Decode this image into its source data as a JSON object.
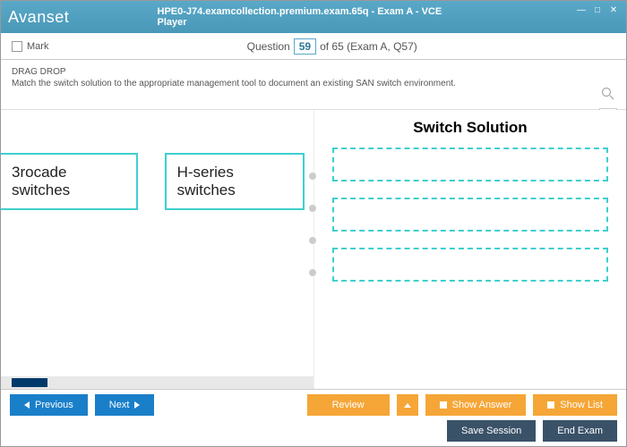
{
  "titlebar": {
    "logo": "Avanset",
    "title": "HPE0-J74.examcollection.premium.exam.65q - Exam A - VCE Player"
  },
  "toolbar": {
    "mark_label": "Mark",
    "question_label": "Question",
    "question_num": "59",
    "question_suffix": "of 65 (Exam A, Q57)"
  },
  "instruct": {
    "heading": "DRAG DROP",
    "text": "Match the switch solution to the appropriate management tool to document an existing SAN switch environment."
  },
  "content": {
    "left_items": [
      "3rocade switches",
      "H-series switches"
    ],
    "solution_title": "Switch Solution"
  },
  "footer": {
    "previous": "Previous",
    "next": "Next",
    "review": "Review",
    "show_answer": "Show Answer",
    "show_list": "Show List",
    "save_session": "Save Session",
    "end_exam": "End Exam"
  }
}
